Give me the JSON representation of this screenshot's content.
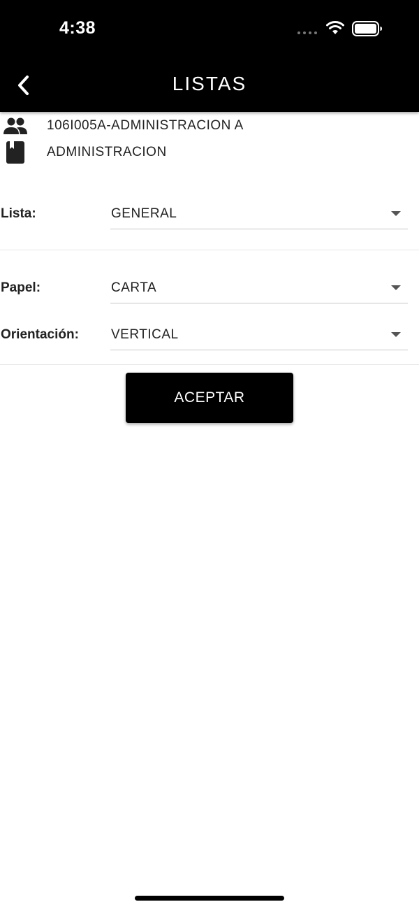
{
  "status_bar": {
    "time": "4:38"
  },
  "app_bar": {
    "title": "LISTAS",
    "back_icon": "chevron-left-icon"
  },
  "info": {
    "group_icon": "people-icon",
    "group_text": "106I005A-ADMINISTRACION A",
    "subject_icon": "book-icon",
    "subject_text": "ADMINISTRACION"
  },
  "form": {
    "lista": {
      "label": "Lista:",
      "value": "GENERAL"
    },
    "papel": {
      "label": "Papel:",
      "value": "CARTA"
    },
    "orientacion": {
      "label": "Orientación:",
      "value": "VERTICAL"
    }
  },
  "actions": {
    "accept_label": "ACEPTAR"
  },
  "colors": {
    "app_bar_bg": "#000000",
    "button_bg": "#000000",
    "text": "#222222",
    "underline": "#c8c8c8"
  }
}
